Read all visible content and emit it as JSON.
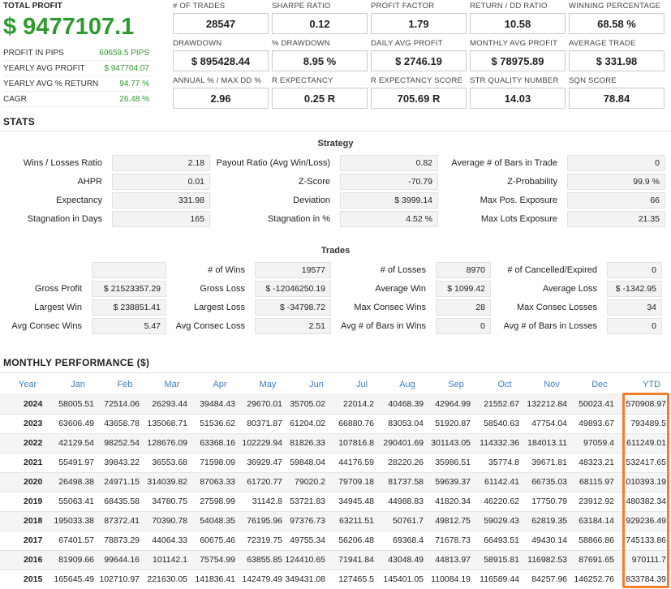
{
  "summary": {
    "total_profit_label": "TOTAL PROFIT",
    "total_profit_value": "$ 9477107.1",
    "rows": [
      {
        "label": "PROFIT IN PIPS",
        "value": "60659.5 PIPS"
      },
      {
        "label": "YEARLY AVG PROFIT",
        "value": "$ 947704.07"
      },
      {
        "label": "YEARLY AVG % RETURN",
        "value": "94.77 %"
      },
      {
        "label": "CAGR",
        "value": "26.48 %"
      }
    ]
  },
  "metrics": [
    [
      {
        "label": "# OF TRADES",
        "value": "28547"
      },
      {
        "label": "SHARPE RATIO",
        "value": "0.12"
      },
      {
        "label": "PROFIT FACTOR",
        "value": "1.79"
      },
      {
        "label": "RETURN / DD RATIO",
        "value": "10.58"
      },
      {
        "label": "WINNING PERCENTAGE",
        "value": "68.58 %"
      }
    ],
    [
      {
        "label": "DRAWDOWN",
        "value": "$ 895428.44"
      },
      {
        "label": "% DRAWDOWN",
        "value": "8.95 %"
      },
      {
        "label": "DAILY AVG PROFIT",
        "value": "$ 2746.19"
      },
      {
        "label": "MONTHLY AVG PROFIT",
        "value": "$ 78975.89"
      },
      {
        "label": "AVERAGE TRADE",
        "value": "$ 331.98"
      }
    ],
    [
      {
        "label": "ANNUAL % / MAX DD %",
        "value": "2.96"
      },
      {
        "label": "R EXPECTANCY",
        "value": "0.25 R"
      },
      {
        "label": "R EXPECTANCY SCORE",
        "value": "705.69 R"
      },
      {
        "label": "STR QUALITY NUMBER",
        "value": "14.03"
      },
      {
        "label": "SQN SCORE",
        "value": "78.84"
      }
    ]
  ],
  "stats": {
    "title": "STATS",
    "strategy_title": "Strategy",
    "strategy_rows": [
      [
        {
          "label": "Wins / Losses Ratio",
          "value": "2.18"
        },
        {
          "label": "Payout Ratio (Avg Win/Loss)",
          "value": "0.82"
        },
        {
          "label": "Average # of Bars in Trade",
          "value": "0"
        }
      ],
      [
        {
          "label": "AHPR",
          "value": "0.01"
        },
        {
          "label": "Z-Score",
          "value": "-70.79"
        },
        {
          "label": "Z-Probability",
          "value": "99.9 %"
        }
      ],
      [
        {
          "label": "Expectancy",
          "value": "331.98"
        },
        {
          "label": "Deviation",
          "value": "$ 3999.14"
        },
        {
          "label": "Max Pos. Exposure",
          "value": "66"
        }
      ],
      [
        {
          "label": "Stagnation in Days",
          "value": "165"
        },
        {
          "label": "Stagnation in %",
          "value": "4.52 %"
        },
        {
          "label": "Max Lots Exposure",
          "value": "21.35"
        }
      ]
    ],
    "trades_title": "Trades",
    "trades_rows": [
      [
        {
          "label": "",
          "value": ""
        },
        {
          "label": "# of Wins",
          "value": "19577"
        },
        {
          "label": "# of Losses",
          "value": "8970"
        },
        {
          "label": "# of Cancelled/Expired",
          "value": "0"
        }
      ],
      [
        {
          "label": "Gross Profit",
          "value": "$ 21523357.29"
        },
        {
          "label": "Gross Loss",
          "value": "$ -12046250.19"
        },
        {
          "label": "Average Win",
          "value": "$ 1099.42"
        },
        {
          "label": "Average Loss",
          "value": "$ -1342.95"
        }
      ],
      [
        {
          "label": "Largest Win",
          "value": "$ 238851.41"
        },
        {
          "label": "Largest Loss",
          "value": "$ -34798.72"
        },
        {
          "label": "Max Consec Wins",
          "value": "28"
        },
        {
          "label": "Max Consec Losses",
          "value": "34"
        }
      ],
      [
        {
          "label": "Avg Consec Wins",
          "value": "5.47"
        },
        {
          "label": "Avg Consec Loss",
          "value": "2.51"
        },
        {
          "label": "Avg # of Bars in Wins",
          "value": "0"
        },
        {
          "label": "Avg # of Bars in Losses",
          "value": "0"
        }
      ]
    ]
  },
  "monthly": {
    "title": "MONTHLY PERFORMANCE ($)",
    "headers": [
      "Year",
      "Jan",
      "Feb",
      "Mar",
      "Apr",
      "May",
      "Jun",
      "Jul",
      "Aug",
      "Sep",
      "Oct",
      "Nov",
      "Dec",
      "YTD"
    ],
    "rows": [
      [
        "2024",
        "58005.51",
        "72514.06",
        "26293.44",
        "39484.43",
        "29670.01",
        "35705.02",
        "22014.2",
        "40468.39",
        "42964.99",
        "21552.67",
        "132212.84",
        "50023.41",
        "570908.97"
      ],
      [
        "2023",
        "63606.49",
        "43658.78",
        "135068.71",
        "51536.62",
        "80371.87",
        "61204.02",
        "66880.76",
        "83053.04",
        "51920.87",
        "58540.63",
        "47754.04",
        "49893.67",
        "793489.5"
      ],
      [
        "2022",
        "42129.54",
        "98252.54",
        "128676.09",
        "63368.16",
        "102229.94",
        "81826.33",
        "107816.8",
        "290401.69",
        "301143.05",
        "114332.36",
        "184013.11",
        "97059.4",
        "611249.01"
      ],
      [
        "2021",
        "55491.97",
        "39843.22",
        "36553.68",
        "71598.09",
        "36929.47",
        "59848.04",
        "44176.59",
        "28220.26",
        "35986.51",
        "35774.8",
        "39671.81",
        "48323.21",
        "532417.65"
      ],
      [
        "2020",
        "26498.38",
        "24971.15",
        "314039.82",
        "87063.33",
        "61720.77",
        "79020.2",
        "79709.18",
        "81737.58",
        "59639.37",
        "61142.41",
        "66735.03",
        "68115.97",
        "010393.19"
      ],
      [
        "2019",
        "55063.41",
        "68435.58",
        "34780.75",
        "27598.99",
        "31142.8",
        "53721.83",
        "34945.48",
        "44988.83",
        "41820.34",
        "46220.62",
        "17750.79",
        "23912.92",
        "480382.34"
      ],
      [
        "2018",
        "195033.38",
        "87372.41",
        "70390.78",
        "54048.35",
        "76195.96",
        "97376.73",
        "63211.51",
        "50761.7",
        "49812.75",
        "59029.43",
        "62819.35",
        "63184.14",
        "929236.49"
      ],
      [
        "2017",
        "67401.57",
        "78873.29",
        "44064.33",
        "60675.46",
        "72319.75",
        "49755.34",
        "56206.48",
        "69368.4",
        "71678.73",
        "66493.51",
        "49430.14",
        "58866.86",
        "745133.86"
      ],
      [
        "2016",
        "81909.66",
        "99644.16",
        "101142.1",
        "75754.99",
        "63855.85",
        "124410.65",
        "71941.84",
        "43048.49",
        "44813.97",
        "58915.81",
        "116982.53",
        "87691.65",
        "970111.7"
      ],
      [
        "2015",
        "165645.49",
        "102710.97",
        "221630.05",
        "141836.41",
        "142479.49",
        "349431.08",
        "127465.5",
        "145401.05",
        "110084.19",
        "116589.44",
        "84257.96",
        "146252.76",
        "833784.39"
      ]
    ]
  },
  "colors": {
    "green": "#2d9a2d",
    "accent_blue": "#3a7fc1",
    "highlight_orange": "#f07e2a"
  }
}
